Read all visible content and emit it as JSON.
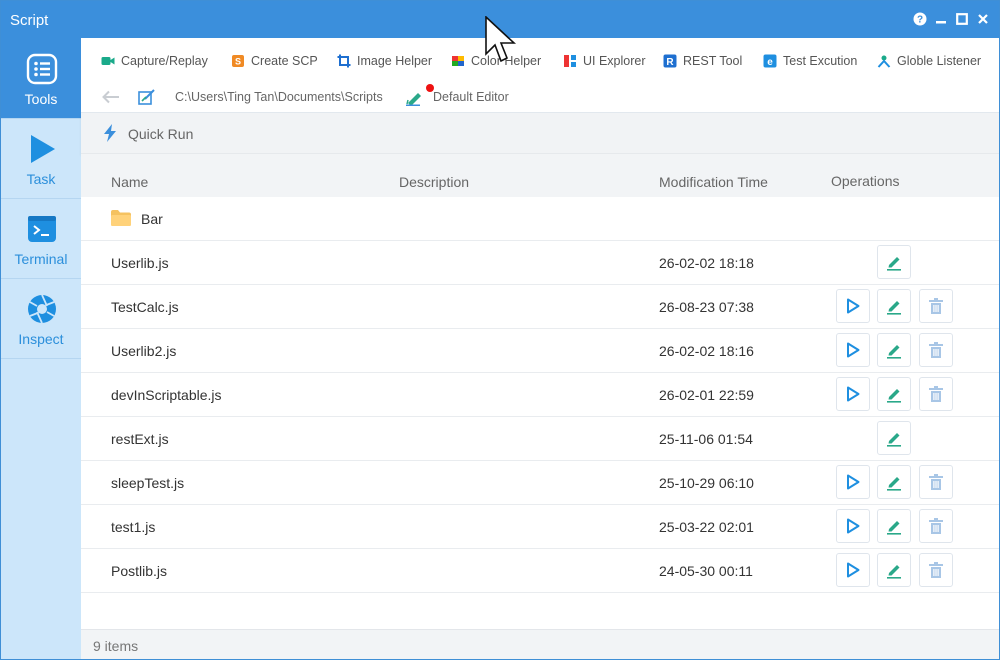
{
  "window": {
    "title": "Script"
  },
  "colors": {
    "accent": "#3b8fdc",
    "sidebar_bg": "#cce6fa",
    "edit_green": "#2aa889",
    "run_blue": "#1e8fe0",
    "notify_red": "#ee1111"
  },
  "sidebar": {
    "items": [
      {
        "label": "Tools",
        "icon": "list-icon",
        "active": true
      },
      {
        "label": "Task",
        "icon": "play-icon",
        "active": false
      },
      {
        "label": "Terminal",
        "icon": "terminal-icon",
        "active": false
      },
      {
        "label": "Inspect",
        "icon": "aperture-icon",
        "active": false
      }
    ]
  },
  "toolbar": {
    "tools": [
      {
        "label": "Capture/Replay",
        "icon": "video-camera-icon"
      },
      {
        "label": "Create SCP",
        "icon": "scp-icon"
      },
      {
        "label": "Image Helper",
        "icon": "crop-icon"
      },
      {
        "label": "Color Helper",
        "icon": "color-palette-icon"
      },
      {
        "label": "UI Explorer",
        "icon": "ui-blocks-icon"
      },
      {
        "label": "REST Tool",
        "icon": "rest-r-icon"
      },
      {
        "label": "Test Excution",
        "icon": "test-e-icon"
      },
      {
        "label": "Globle Listener",
        "icon": "listener-icon"
      }
    ],
    "path": "C:\\Users\\Ting Tan\\Documents\\Scripts",
    "editor": "Default Editor"
  },
  "quick_run": {
    "label": "Quick Run"
  },
  "table": {
    "headers": {
      "name": "Name",
      "description": "Description",
      "modified": "Modification Time",
      "operations": "Operations"
    },
    "rows": [
      {
        "name": "Bar",
        "type": "folder",
        "modified": "",
        "ops": []
      },
      {
        "name": "Userlib.js",
        "type": "file",
        "modified": "26-02-02 18:18",
        "ops": [
          "edit"
        ]
      },
      {
        "name": "TestCalc.js",
        "type": "file",
        "modified": "26-08-23 07:38",
        "ops": [
          "run",
          "edit",
          "delete"
        ]
      },
      {
        "name": "Userlib2.js",
        "type": "file",
        "modified": "26-02-02 18:16",
        "ops": [
          "run",
          "edit",
          "delete"
        ]
      },
      {
        "name": "devInScriptable.js",
        "type": "file",
        "modified": "26-02-01 22:59",
        "ops": [
          "run",
          "edit",
          "delete"
        ]
      },
      {
        "name": "restExt.js",
        "type": "file",
        "modified": "25-11-06 01:54",
        "ops": [
          "edit"
        ]
      },
      {
        "name": "sleepTest.js",
        "type": "file",
        "modified": "25-10-29 06:10",
        "ops": [
          "run",
          "edit",
          "delete"
        ]
      },
      {
        "name": "test1.js",
        "type": "file",
        "modified": "25-03-22 02:01",
        "ops": [
          "run",
          "edit",
          "delete"
        ]
      },
      {
        "name": "Postlib.js",
        "type": "file",
        "modified": "24-05-30 00:11",
        "ops": [
          "run",
          "edit",
          "delete"
        ]
      }
    ]
  },
  "footer": {
    "count": "9 items"
  }
}
